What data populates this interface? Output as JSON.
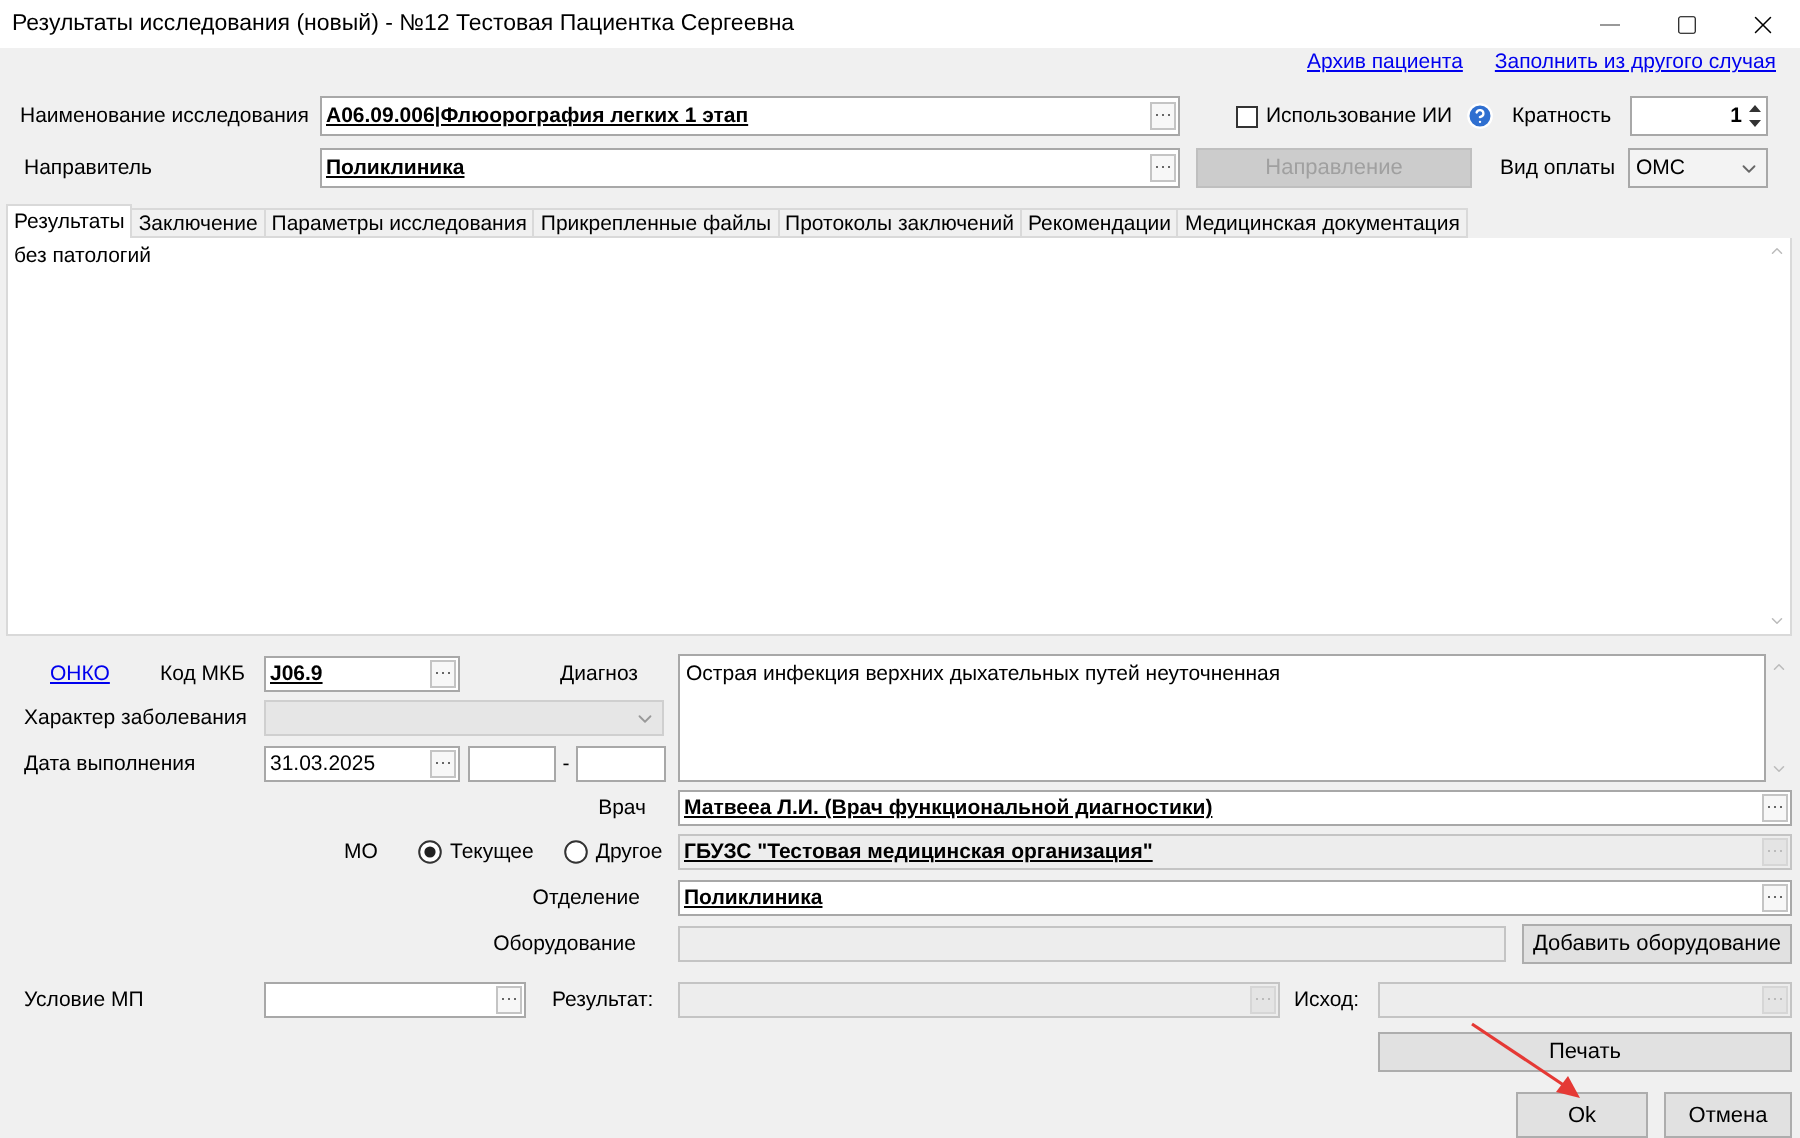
{
  "window": {
    "title": "Результаты исследования (новый) - №12 Тестовая Пациентка Сергеевна"
  },
  "header_links": [
    "Архив пациента",
    "Заполнить из другого случая"
  ],
  "study_name": {
    "label": "Наименование исследования",
    "value": "A06.09.006|Флюорография легких 1 этап"
  },
  "ai_use": {
    "label": "Использование ИИ",
    "checked": false
  },
  "multiplicity": {
    "label": "Кратность",
    "value": "1"
  },
  "referrer": {
    "label": "Направитель",
    "value": "Поликлиника"
  },
  "referral_button": {
    "label": "Направление",
    "disabled": true
  },
  "payment_type": {
    "label": "Вид оплаты",
    "value": "ОМС"
  },
  "tabs": [
    {
      "label": "Результаты",
      "selected": true
    },
    {
      "label": "Заключение",
      "selected": false
    },
    {
      "label": "Параметры исследования",
      "selected": false
    },
    {
      "label": "Прикрепленные файлы",
      "selected": false
    },
    {
      "label": "Протоколы заключений",
      "selected": false
    },
    {
      "label": "Рекомендации",
      "selected": false
    },
    {
      "label": "Медицинская документация",
      "selected": false
    }
  ],
  "results_text": "без патологий",
  "onko_link": "ОНКО",
  "icd_code": {
    "label": "Код МКБ",
    "value": "J06.9"
  },
  "diagnosis": {
    "label": "Диагноз",
    "value": "Острая инфекция верхних дыхательных путей неуточненная"
  },
  "disease_character": {
    "label": "Характер заболевания",
    "disabled": true
  },
  "execution_date": {
    "label": "Дата выполнения",
    "value": "31.03.2025",
    "separator": "-"
  },
  "doctor": {
    "label": "Врач",
    "value": "Матвееа Л.И. (Врач функциональной диагностики)"
  },
  "mo": {
    "label": "МО",
    "options": [
      {
        "label": "Текущее",
        "selected": true
      },
      {
        "label": "Другое",
        "selected": false
      }
    ],
    "value": "ГБУЗС \"Тестовая медицинская организация\"",
    "disabled": true
  },
  "department": {
    "label": "Отделение",
    "value": "Поликлиника"
  },
  "equipment": {
    "label": "Оборудование",
    "disabled": true,
    "button": "Добавить оборудование"
  },
  "care_condition": {
    "label": "Условие МП"
  },
  "result": {
    "label": "Результат:",
    "disabled": true
  },
  "outcome": {
    "label": "Исход:",
    "disabled": true
  },
  "print_button": "Печать",
  "ok_button": "Ok",
  "cancel_button": "Отмена"
}
